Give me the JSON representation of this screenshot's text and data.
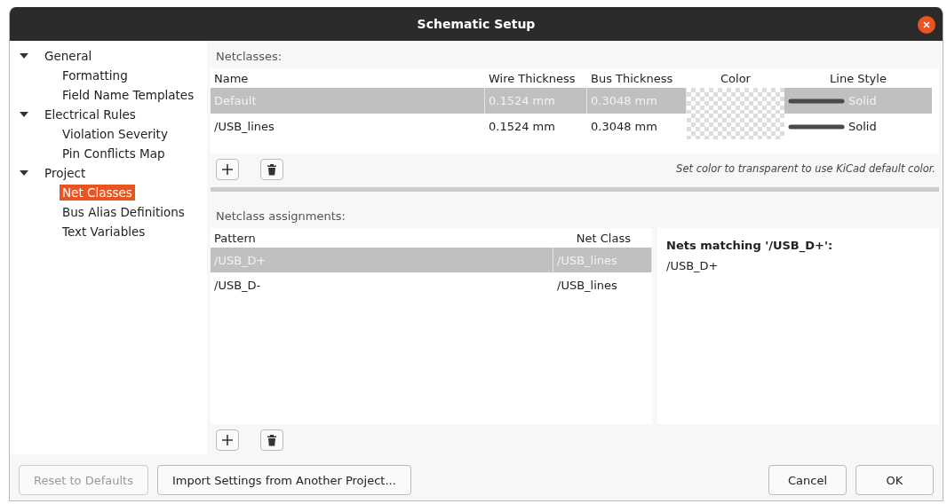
{
  "window": {
    "title": "Schematic Setup"
  },
  "sidebar": {
    "items": [
      {
        "label": "General",
        "expanded": true,
        "selected": false,
        "children": [
          {
            "label": "Formatting",
            "selected": false
          },
          {
            "label": "Field Name Templates",
            "selected": false
          }
        ]
      },
      {
        "label": "Electrical Rules",
        "expanded": true,
        "selected": false,
        "children": [
          {
            "label": "Violation Severity",
            "selected": false
          },
          {
            "label": "Pin Conflicts Map",
            "selected": false
          }
        ]
      },
      {
        "label": "Project",
        "expanded": true,
        "selected": false,
        "children": [
          {
            "label": "Net Classes",
            "selected": true
          },
          {
            "label": "Bus Alias Definitions",
            "selected": false
          },
          {
            "label": "Text Variables",
            "selected": false
          }
        ]
      }
    ]
  },
  "netclasses": {
    "label": "Netclasses:",
    "columns": [
      "Name",
      "Wire Thickness",
      "Bus Thickness",
      "Color",
      "Line Style"
    ],
    "rows": [
      {
        "name": "Default",
        "wire": "0.1524 mm",
        "bus": "0.3048 mm",
        "line_style": "Solid",
        "selected": true
      },
      {
        "name": "/USB_lines",
        "wire": "0.1524 mm",
        "bus": "0.3048 mm",
        "line_style": "Solid",
        "selected": false
      }
    ],
    "note": "Set color to transparent to use KiCad default color."
  },
  "assignments": {
    "label": "Netclass assignments:",
    "columns": [
      "Pattern",
      "Net Class"
    ],
    "rows": [
      {
        "pattern": "/USB_D+",
        "net_class": "/USB_lines",
        "selected": true
      },
      {
        "pattern": "/USB_D-",
        "net_class": "/USB_lines",
        "selected": false
      }
    ],
    "matches": {
      "title": "Nets matching '/USB_D+':",
      "items": [
        "/USB_D+"
      ]
    }
  },
  "footer": {
    "left": [
      {
        "label": "Reset to Defaults",
        "disabled": true
      },
      {
        "label": "Import Settings from Another Project...",
        "disabled": false
      }
    ],
    "right": [
      {
        "label": "Cancel",
        "disabled": false
      },
      {
        "label": "OK",
        "disabled": false
      }
    ]
  }
}
